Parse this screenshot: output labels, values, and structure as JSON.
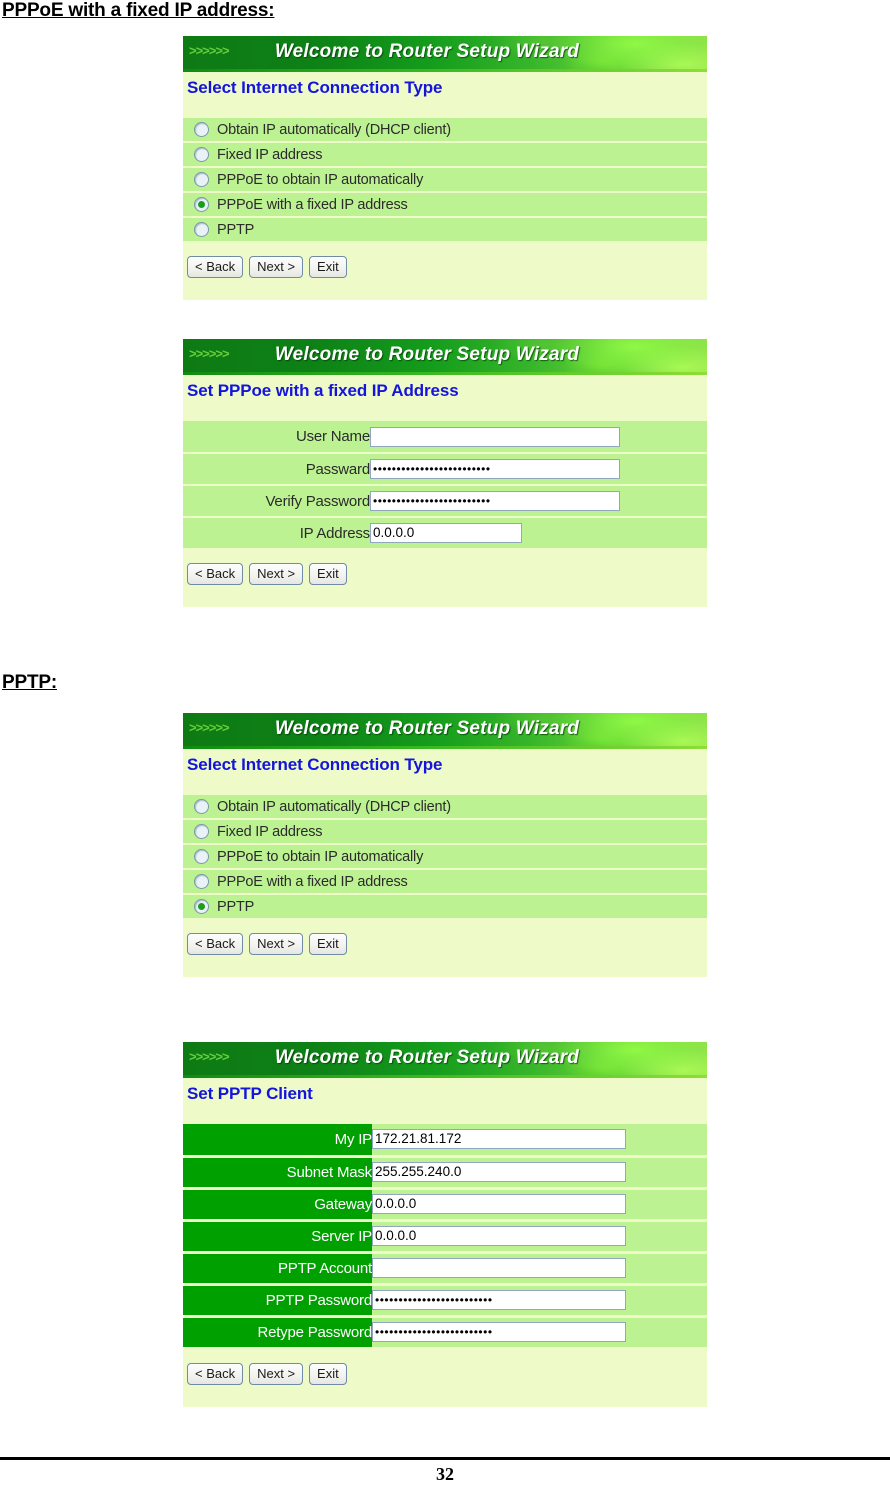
{
  "document": {
    "sections": [
      {
        "heading": "PPPoE with a fixed IP address:"
      },
      {
        "heading": "PPTP:"
      }
    ],
    "footer": {
      "page_number": "32"
    }
  },
  "banner": {
    "chevrons": ">>>>>>",
    "title": "Welcome to Router Setup Wizard"
  },
  "buttons": {
    "back": "< Back",
    "next": "Next >",
    "exit": "Exit"
  },
  "connection_type_options": [
    "Obtain IP automatically (DHCP client)",
    "Fixed IP address",
    "PPPoE to obtain IP automatically",
    "PPPoE with a fixed IP address",
    "PPTP"
  ],
  "panel_1": {
    "title": "Select Internet Connection Type",
    "selected_option": "PPPoE with a fixed IP address",
    "options": [
      {
        "label": "Obtain IP automatically (DHCP client)",
        "selected": false
      },
      {
        "label": "Fixed IP address",
        "selected": false
      },
      {
        "label": "PPPoE to obtain IP automatically",
        "selected": false
      },
      {
        "label": "PPPoE with a fixed IP address",
        "selected": true
      },
      {
        "label": "PPTP",
        "selected": false
      }
    ]
  },
  "panel_2": {
    "title": "Set PPPoe with a fixed IP Address",
    "fields": [
      {
        "label": "User Name",
        "value": "",
        "type": "text",
        "width": "wide"
      },
      {
        "label": "Passward",
        "value": "•••••••••••••••••••••••••",
        "type": "password",
        "width": "wide"
      },
      {
        "label": "Verify Password",
        "value": "•••••••••••••••••••••••••",
        "type": "password",
        "width": "wide"
      },
      {
        "label": "IP Address",
        "value": "0.0.0.0",
        "type": "text",
        "width": "narrow"
      }
    ]
  },
  "panel_3": {
    "title": "Select Internet Connection Type",
    "selected_option": "PPTP",
    "options": [
      {
        "label": "Obtain IP automatically (DHCP client)",
        "selected": false
      },
      {
        "label": "Fixed IP address",
        "selected": false
      },
      {
        "label": "PPPoE to obtain IP automatically",
        "selected": false
      },
      {
        "label": "PPPoE with a fixed IP address",
        "selected": false
      },
      {
        "label": "PPTP",
        "selected": true
      }
    ]
  },
  "panel_4": {
    "title": "Set PPTP Client",
    "fields": [
      {
        "label": "My IP",
        "value": "172.21.81.172",
        "type": "text"
      },
      {
        "label": "Subnet Mask",
        "value": "255.255.240.0",
        "type": "text"
      },
      {
        "label": "Gateway",
        "value": "0.0.0.0",
        "type": "text"
      },
      {
        "label": "Server IP",
        "value": "0.0.0.0",
        "type": "text"
      },
      {
        "label": "PPTP Account",
        "value": "",
        "type": "text"
      },
      {
        "label": "PPTP Password",
        "value": "•••••••••••••••••••••••••",
        "type": "password"
      },
      {
        "label": "Retype Password",
        "value": "•••••••••••••••••••••••••",
        "type": "password"
      }
    ]
  },
  "colors": {
    "banner_dark_green": "#0e7a14",
    "banner_light_green": "#8ee04a",
    "panel_background": "#eefac8",
    "row_green": "#bdf292",
    "label_cell_green": "#00a000",
    "title_blue": "#1414dc"
  }
}
